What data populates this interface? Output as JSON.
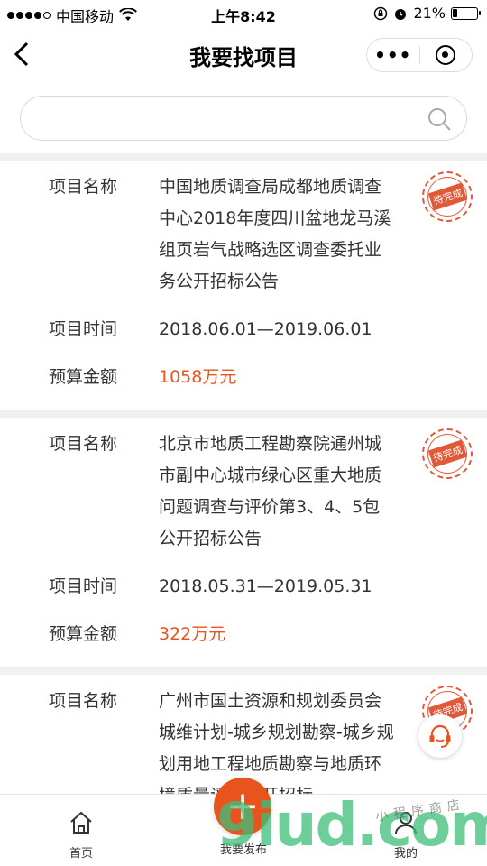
{
  "status_bar": {
    "carrier": "中国移动",
    "time": "上午8:42",
    "battery": "21%",
    "battery_level": 0.21
  },
  "nav": {
    "title": "我要找项目"
  },
  "search": {
    "placeholder": ""
  },
  "labels": {
    "name": "项目名称",
    "time": "项目时间",
    "budget": "预算金额"
  },
  "projects": [
    {
      "name": "中国地质调查局成都地质调查中心2018年度四川盆地龙马溪组页岩气战略选区调查委托业务公开招标公告",
      "time": "2018.06.01—2019.06.01",
      "budget": "1058万元",
      "status": "待完成"
    },
    {
      "name": "北京市地质工程勘察院通州城市副中心城市绿心区重大地质问题调查与评价第3、4、5包公开招标公告",
      "time": "2018.05.31—2019.05.31",
      "budget": "322万元",
      "status": "待完成"
    },
    {
      "name": "广州市国土资源和规划委员会城维计划-城乡规划勘察-城乡规划用地工程地质勘察与地质环境质量评价公开招标",
      "status": "待完成"
    }
  ],
  "tabs": {
    "home": "首页",
    "publish": "我要发布",
    "mine": "我的"
  },
  "watermark": {
    "logo": "9iud.com",
    "text": "小程序商店"
  },
  "colors": {
    "accent": "#e8541e",
    "stamp": "#e05a3a"
  },
  "icons": [
    "back-arrow-icon",
    "more-dots-icon",
    "close-circle-icon",
    "search-icon",
    "headset-icon",
    "home-icon",
    "plus-icon",
    "user-icon"
  ]
}
